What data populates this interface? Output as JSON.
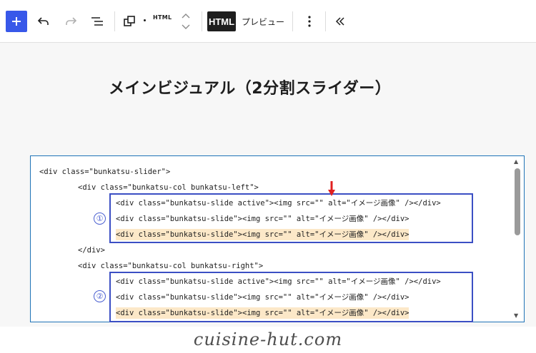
{
  "toolbar": {
    "html_small_label": "HTML",
    "html_button_label": "HTML",
    "preview_label": "プレビュー"
  },
  "title": "メインビジュアル（2分割スライダー）",
  "code": {
    "lines": [
      "<div class=\"bunkatsu-slider\">",
      "<div class=\"bunkatsu-col bunkatsu-left\">",
      "<div class=\"bunkatsu-slide active\"><img src=\"\" alt=\"イメージ画像\" /></div>",
      "<div class=\"bunkatsu-slide\"><img src=\"\" alt=\"イメージ画像\" /></div>",
      "<div class=\"bunkatsu-slide\"><img src=\"\" alt=\"イメージ画像\" /></div>",
      "</div>",
      "<div class=\"bunkatsu-col bunkatsu-right\">",
      "<div class=\"bunkatsu-slide active\"><img src=\"\" alt=\"イメージ画像\" /></div>",
      "<div class=\"bunkatsu-slide\"><img src=\"\" alt=\"イメージ画像\" /></div>",
      "<div class=\"bunkatsu-slide\"><img src=\"\" alt=\"イメージ画像\" /></div>"
    ]
  },
  "annotations": {
    "marker_1": "①",
    "marker_2": "②"
  },
  "watermark": "cuisine-hut.com",
  "colors": {
    "accent": "#3858e9",
    "editor_border": "#1f73b7",
    "group_box": "#3b4fc4",
    "highlight": "#fce8c8",
    "arrow": "#e02020"
  },
  "icons": [
    "plus-icon",
    "undo-icon",
    "redo-icon",
    "list-view-icon",
    "block-transform-icon",
    "move-up-down-icon",
    "more-options-icon",
    "collapse-icon",
    "arrow-down-icon"
  ]
}
